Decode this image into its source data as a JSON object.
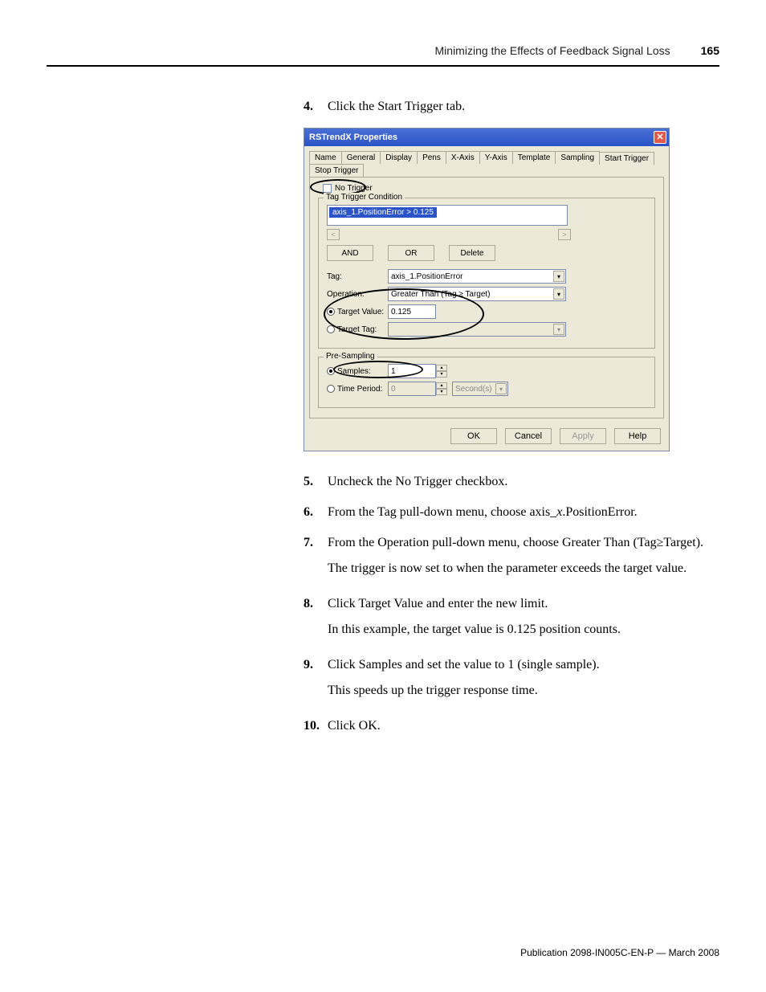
{
  "header": {
    "title": "Minimizing the Effects of Feedback Signal Loss",
    "page": "165"
  },
  "steps": {
    "s4": {
      "num": "4.",
      "txt": "Click the Start Trigger tab."
    },
    "s5": {
      "num": "5.",
      "txt": "Uncheck the No Trigger checkbox."
    },
    "s6": {
      "num": "6.",
      "txt_a": "From the Tag pull-down menu, choose axis_",
      "txt_i": "x",
      "txt_b": ".PositionError."
    },
    "s7": {
      "num": "7.",
      "txt": "From the Operation pull-down menu, choose Greater Than (Tag≥Target).",
      "follow": "The trigger is now set to when the parameter exceeds the target value."
    },
    "s8": {
      "num": "8.",
      "txt": "Click Target Value and enter the new limit.",
      "follow": "In this example, the target value is 0.125 position counts."
    },
    "s9": {
      "num": "9.",
      "txt": "Click Samples and set the value to 1 (single sample).",
      "follow": "This speeds up the trigger response time."
    },
    "s10": {
      "num": "10.",
      "txt": "Click OK."
    }
  },
  "dialog": {
    "title": "RSTrendX Properties",
    "tabs": [
      "Name",
      "General",
      "Display",
      "Pens",
      "X-Axis",
      "Y-Axis",
      "Template",
      "Sampling",
      "Start Trigger",
      "Stop Trigger"
    ],
    "active_tab": "Start Trigger",
    "no_trigger_label": "No Trigger",
    "ttc_legend": "Tag Trigger Condition",
    "condition_line": "axis_1.PositionError >  0.125",
    "btn_and": "AND",
    "btn_or": "OR",
    "btn_delete": "Delete",
    "row_tag_label": "Tag:",
    "row_tag_value": "axis_1.PositionError",
    "row_op_label": "Operation:",
    "row_op_value": "Greater Than (Tag ≥ Target)",
    "row_tv_label": "Target Value:",
    "row_tv_value": "0.125",
    "row_tt_label": "Target Tag:",
    "row_tt_value": "",
    "ps_legend": "Pre-Sampling",
    "row_samples_label": "Samples:",
    "row_samples_value": "1",
    "row_tp_label": "Time Period:",
    "row_tp_value": "0",
    "row_tp_unit": "Second(s)",
    "btn_ok": "OK",
    "btn_cancel": "Cancel",
    "btn_apply": "Apply",
    "btn_help": "Help"
  },
  "footer": "Publication 2098-IN005C-EN-P — March 2008"
}
